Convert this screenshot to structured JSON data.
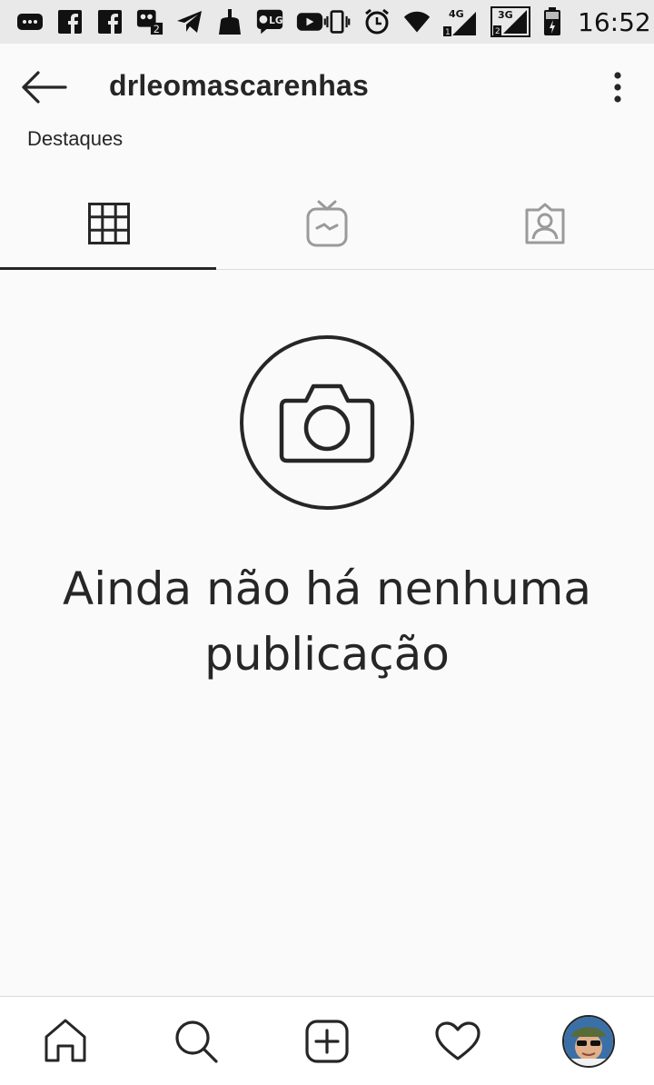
{
  "status_bar": {
    "time": "16:52",
    "left_icons": [
      "messages-icon",
      "facebook-icon",
      "facebook-icon",
      "app-notification-icon",
      "telegram-icon",
      "cleaner-icon",
      "lg-message-icon",
      "youtube-icon"
    ],
    "right_icons": [
      "vibrate-icon",
      "alarm-icon",
      "wifi-icon",
      "signal-4g-icon",
      "signal-3g-icon",
      "battery-icon"
    ],
    "network_4g": "4G",
    "network_3g": "3G"
  },
  "header": {
    "username": "drleomascarenhas"
  },
  "highlights_label": "Destaques",
  "tabs": [
    {
      "name": "grid",
      "icon": "grid-icon",
      "active": true
    },
    {
      "name": "igtv",
      "icon": "igtv-icon",
      "active": false
    },
    {
      "name": "tagged",
      "icon": "tagged-icon",
      "active": false
    }
  ],
  "empty_state": {
    "line1": "Ainda não há nenhuma",
    "line2": "publicação"
  },
  "bottom_nav": {
    "items": [
      "home-icon",
      "search-icon",
      "add-post-icon",
      "activity-heart-icon",
      "profile-avatar"
    ]
  },
  "colors": {
    "text": "#262626",
    "background": "#fafafa",
    "status_bar": "#e9e9e9",
    "divider": "#dbdbdb"
  }
}
